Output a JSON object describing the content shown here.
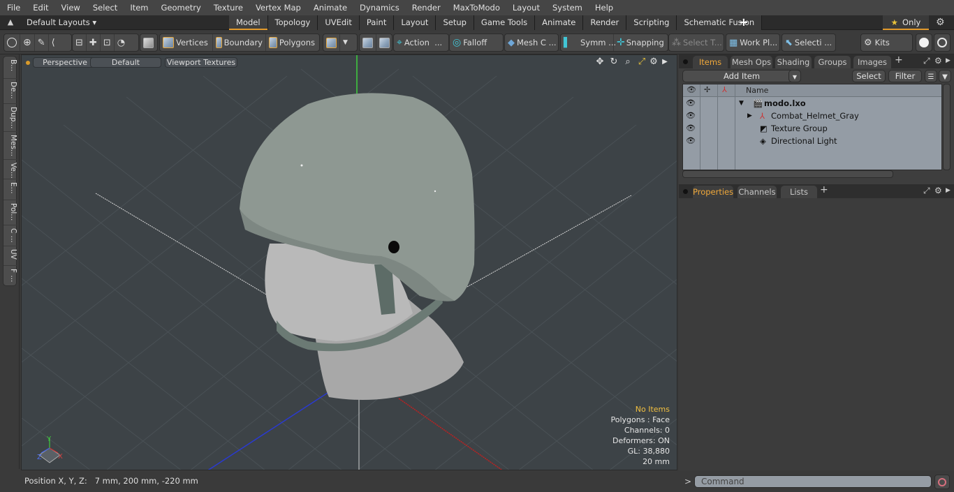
{
  "menu": [
    "File",
    "Edit",
    "View",
    "Select",
    "Item",
    "Geometry",
    "Texture",
    "Vertex Map",
    "Animate",
    "Dynamics",
    "Render",
    "MaxToModo",
    "Layout",
    "System",
    "Help"
  ],
  "layouts": {
    "selector": "Default Layouts ▾",
    "tabs": [
      "Model",
      "Topology",
      "UVEdit",
      "Paint",
      "Layout",
      "Setup",
      "Game Tools",
      "Animate",
      "Render",
      "Scripting",
      "Schematic Fusion"
    ],
    "active_tab": "Model",
    "add": "+",
    "only_label": "Only",
    "star": "★"
  },
  "toolbar": {
    "vertices": "Vertices",
    "boundary": "Boundary",
    "polygons": "Polygons",
    "action": "Action",
    "falloff": "Falloff",
    "mesh_constraints": "Mesh C ...",
    "symmetry": "Symm ...",
    "snapping": "Snapping",
    "select_through": "Select T...",
    "work_plane": "Work Pl...",
    "selection_sets": "Selecti ...",
    "kits": "Kits",
    "ellipsis": "..."
  },
  "left_tabs": [
    "B...",
    "De...",
    "Dup...",
    "Mes...",
    "Ve...",
    "E...",
    "Pol...",
    "C ...",
    "UV",
    "F ..."
  ],
  "viewport": {
    "view_mode": "Perspective",
    "shading": "Default",
    "textures": "Viewport Textures",
    "info": {
      "selection": "No Items",
      "polygons": "Polygons : Face",
      "channels": "Channels: 0",
      "deformers": "Deformers: ON",
      "gl": "GL: 38,880",
      "grid": "20 mm"
    },
    "axes": {
      "x": "X",
      "y": "Y",
      "z": "Z"
    },
    "colors": {
      "background": "#3d4347",
      "helmet": "#8e9892",
      "accent": "#e39a2b"
    }
  },
  "status": {
    "position_label": "Position X, Y, Z:",
    "position_value": "7 mm, 200 mm, -220 mm"
  },
  "items_panel": {
    "tabs": [
      "Items",
      "Mesh Ops",
      "Shading",
      "Groups",
      "Images"
    ],
    "active_tab": "Items",
    "add_item": "Add Item",
    "select": "Select",
    "filter": "Filter",
    "column_name": "Name",
    "rows": [
      {
        "name": "modo.lxo",
        "icon": "scene-icon",
        "bold": true
      },
      {
        "name": "Combat_Helmet_Gray",
        "icon": "mesh-locator-icon"
      },
      {
        "name": "Texture Group",
        "icon": "texture-group-icon"
      },
      {
        "name": "Directional Light",
        "icon": "light-icon"
      }
    ]
  },
  "properties_panel": {
    "tabs": [
      "Properties",
      "Channels",
      "Lists"
    ],
    "active_tab": "Properties"
  },
  "command": {
    "prompt": ">",
    "placeholder": "Command"
  }
}
